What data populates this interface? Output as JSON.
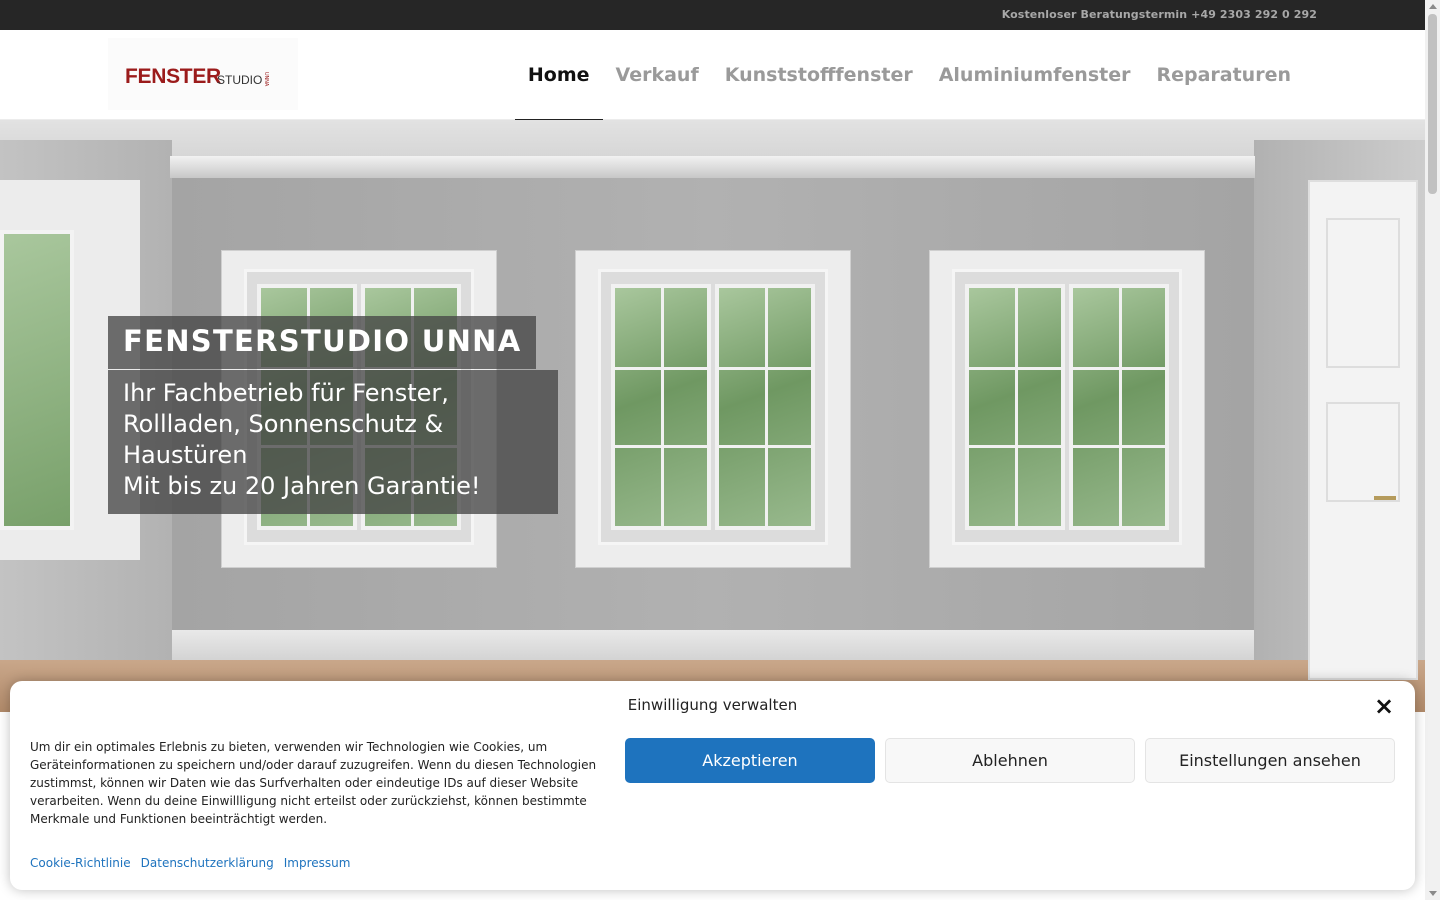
{
  "topbar": {
    "text": "Kostenloser Beratungstermin +49 2303 292 0 292"
  },
  "logo": {
    "main": "FENSTER",
    "sub": "STUDIO",
    "tag": "UNNA"
  },
  "nav": {
    "items": [
      {
        "label": "Home",
        "active": true
      },
      {
        "label": "Verkauf",
        "active": false
      },
      {
        "label": "Kunststofffenster",
        "active": false
      },
      {
        "label": "Aluminiumfenster",
        "active": false
      },
      {
        "label": "Reparaturen",
        "active": false
      }
    ]
  },
  "hero": {
    "title": "FENSTERSTUDIO UNNA",
    "subtitle_line1": "Ihr Fachbetrieb für Fenster,",
    "subtitle_line2": "Rollladen, Sonnenschutz &",
    "subtitle_line3": "Haustüren",
    "subtitle_line4": "Mit bis zu 20 Jahren Garantie!"
  },
  "cookie": {
    "title": "Einwilligung verwalten",
    "close_icon": "close-icon",
    "text": "Um dir ein optimales Erlebnis zu bieten, verwenden wir Technologien wie Cookies, um Geräteinformationen zu speichern und/oder darauf zuzugreifen. Wenn du diesen Technologien zustimmst, können wir Daten wie das Surfverhalten oder eindeutige IDs auf dieser Website verarbeiten. Wenn du deine Einwillligung nicht erteilst oder zurückziehst, können bestimmte Merkmale und Funktionen beeinträchtigt werden.",
    "accept_label": "Akzeptieren",
    "deny_label": "Ablehnen",
    "settings_label": "Einstellungen ansehen",
    "links": [
      "Cookie-Richtlinie",
      "Datenschutzerklärung",
      "Impressum"
    ]
  },
  "colors": {
    "accent": "#1e73be",
    "brand": "#9b1b1b",
    "topbar": "#262626"
  }
}
